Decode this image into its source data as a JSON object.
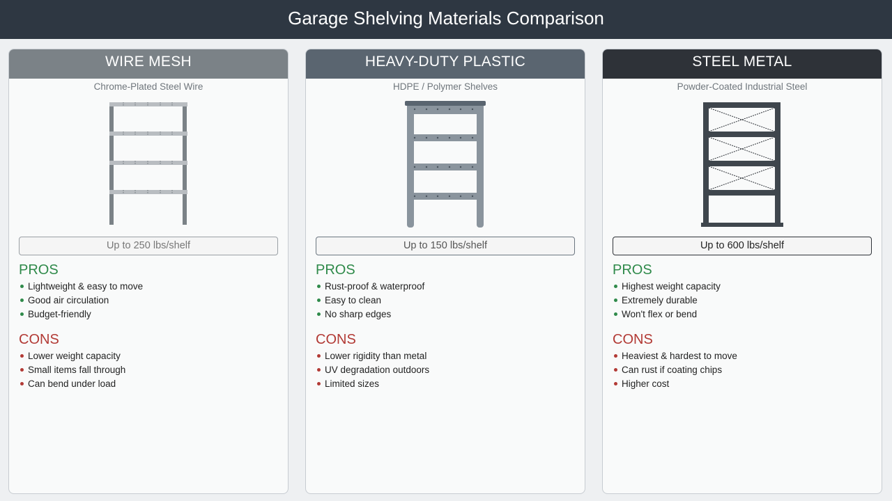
{
  "header": {
    "title": "Garage Shelving Materials Comparison"
  },
  "cards": [
    {
      "name": "WIRE MESH",
      "subtitle": "Chrome-Plated Steel Wire",
      "capacity": "Up to 250 lbs/shelf",
      "pros_title": "PROS",
      "pros": [
        "Lightweight & easy to move",
        "Good air circulation",
        "Budget-friendly"
      ],
      "cons_title": "CONS",
      "cons": [
        "Lower weight capacity",
        "Small items fall through",
        "Can bend under load"
      ]
    },
    {
      "name": "HEAVY-DUTY PLASTIC",
      "subtitle": "HDPE / Polymer Shelves",
      "capacity": "Up to 150 lbs/shelf",
      "pros_title": "PROS",
      "pros": [
        "Rust-proof & waterproof",
        "Easy to clean",
        "No sharp edges"
      ],
      "cons_title": "CONS",
      "cons": [
        "Lower rigidity than metal",
        "UV degradation outdoors",
        "Limited sizes"
      ]
    },
    {
      "name": "STEEL METAL",
      "subtitle": "Powder-Coated Industrial Steel",
      "capacity": "Up to 600 lbs/shelf",
      "pros_title": "PROS",
      "pros": [
        "Highest weight capacity",
        "Extremely durable",
        "Won't flex or bend"
      ],
      "cons_title": "CONS",
      "cons": [
        "Heaviest & hardest to move",
        "Can rust if coating chips",
        "Higher cost"
      ]
    }
  ],
  "colors": {
    "header_bg": "#2e3742",
    "wire_mesh": "#7b8287",
    "plastic": "#5a6570",
    "steel": "#2e3238",
    "pros": "#2f8a4a",
    "cons": "#b23a35"
  }
}
